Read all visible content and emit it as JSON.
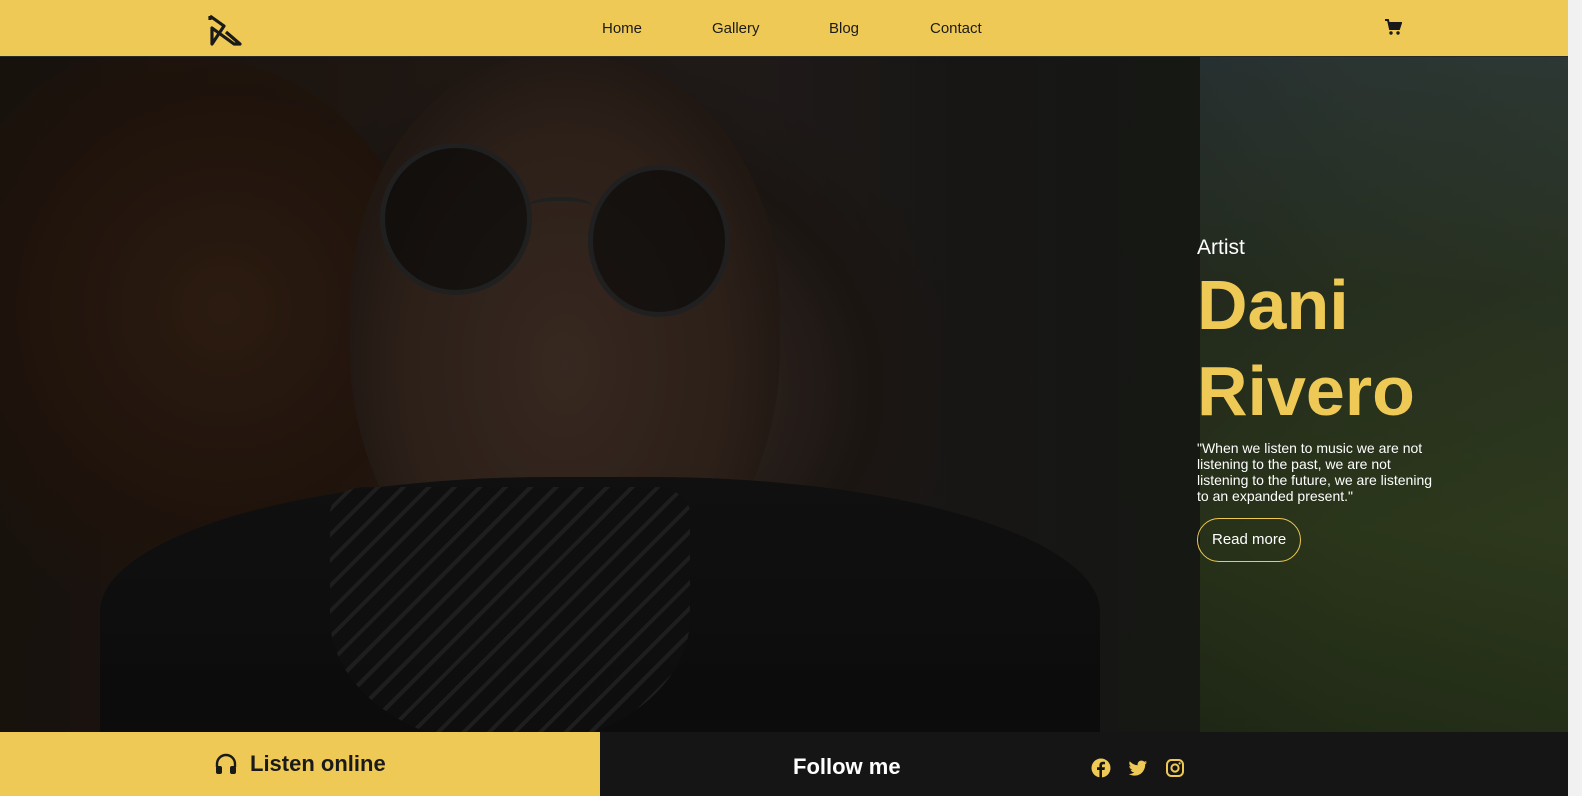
{
  "header": {
    "logo_icon": "dr-logo-icon",
    "nav": [
      {
        "label": "Home"
      },
      {
        "label": "Gallery"
      },
      {
        "label": "Blog"
      },
      {
        "label": "Contact"
      }
    ],
    "cart_icon": "shopping-cart-icon"
  },
  "hero": {
    "role": "Artist",
    "name_first": "Dani",
    "name_last": "Rivero",
    "quote": "\"When we listen to music we are not listening to the past, we are not listening to the future, we are listening to an expanded present.\"",
    "cta_label": "Read more"
  },
  "bottom": {
    "listen_label": "Listen online",
    "listen_icon": "headphones-icon",
    "follow_label": "Follow me",
    "social": [
      {
        "name": "facebook-icon"
      },
      {
        "name": "twitter-icon"
      },
      {
        "name": "instagram-icon"
      }
    ]
  },
  "colors": {
    "accent": "#efc955",
    "dark": "#151515",
    "text_light": "#ffffff"
  }
}
